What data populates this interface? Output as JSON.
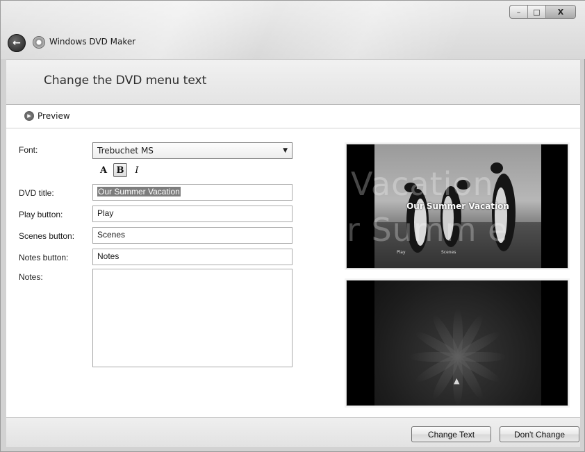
{
  "window": {
    "title": "Windows DVD Maker",
    "controls": {
      "minimize": "–",
      "maximize": "□",
      "close": "X"
    }
  },
  "header": {
    "title": "Change the DVD menu text"
  },
  "toolbar": {
    "preview_label": "Preview"
  },
  "form": {
    "font_label": "Font:",
    "font_value": "Trebuchet MS",
    "style_buttons": {
      "regular": "A",
      "bold": "B",
      "italic": "I",
      "active": "bold"
    },
    "dvd_title_label": "DVD title:",
    "dvd_title_value": "Our Summer Vacation",
    "play_label": "Play button:",
    "play_value": "Play",
    "scenes_label": "Scenes button:",
    "scenes_value": "Scenes",
    "notes_button_label": "Notes button:",
    "notes_button_value": "Notes",
    "notes_label": "Notes:",
    "notes_value": ""
  },
  "preview": {
    "menu_title": "Our Summer Vacation",
    "background_word_1": "Vacation",
    "background_word_2": "r Summ e",
    "play_item": "Play",
    "scenes_item": "Scenes"
  },
  "footer": {
    "change_text_label": "Change Text",
    "dont_change_label": "Don't Change"
  }
}
